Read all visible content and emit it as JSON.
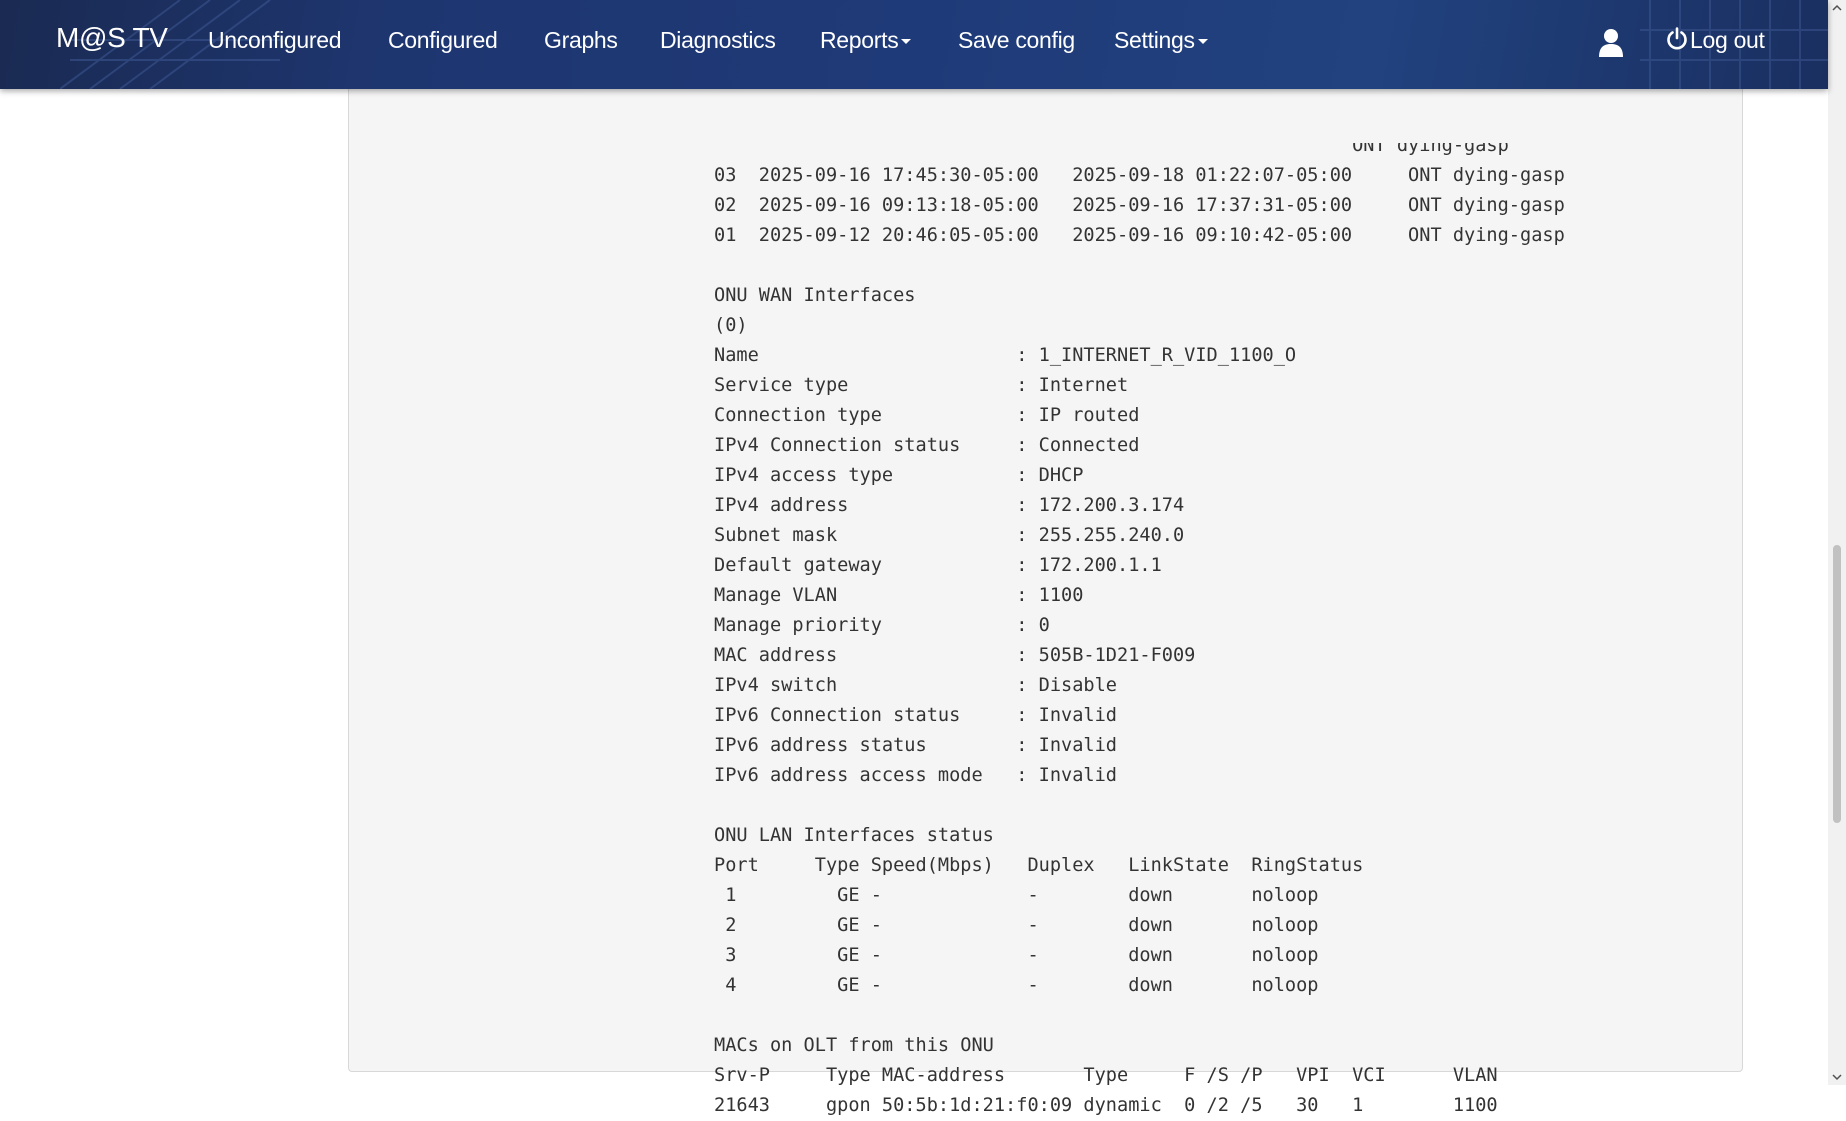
{
  "navbar": {
    "brand": "M@S TV",
    "items": [
      {
        "label": "Unconfigured"
      },
      {
        "label": "Configured"
      },
      {
        "label": "Graphs"
      },
      {
        "label": "Diagnostics"
      },
      {
        "label": "Reports"
      },
      {
        "label": "Save config"
      },
      {
        "label": "Settings"
      }
    ],
    "logout_label": "Log out",
    "user_icon": "user-icon",
    "power_icon": "power-icon",
    "colors": {
      "background": "#1f3a78",
      "text": "#ffffff"
    }
  },
  "content": {
    "lines": [
      "                                                         ONT dying-gasp",
      "03  2025-09-16 17:45:30-05:00   2025-09-18 01:22:07-05:00     ONT dying-gasp",
      "02  2025-09-16 09:13:18-05:00   2025-09-16 17:37:31-05:00     ONT dying-gasp",
      "01  2025-09-12 20:46:05-05:00   2025-09-16 09:10:42-05:00     ONT dying-gasp",
      "",
      "ONU WAN Interfaces",
      "(0)",
      "Name                       : 1_INTERNET_R_VID_1100_O",
      "Service type               : Internet",
      "Connection type            : IP routed",
      "IPv4 Connection status     : Connected",
      "IPv4 access type           : DHCP",
      "IPv4 address               : 172.200.3.174",
      "Subnet mask                : 255.255.240.0",
      "Default gateway            : 172.200.1.1",
      "Manage VLAN                : 1100",
      "Manage priority            : 0",
      "MAC address                : 505B-1D21-F009",
      "IPv4 switch                : Disable",
      "IPv6 Connection status     : Invalid",
      "IPv6 address status        : Invalid",
      "IPv6 address access mode   : Invalid",
      "",
      "ONU LAN Interfaces status",
      "Port     Type Speed(Mbps)   Duplex   LinkState  RingStatus",
      " 1         GE -             -        down       noloop",
      " 2         GE -             -        down       noloop",
      " 3         GE -             -        down       noloop",
      " 4         GE -             -        down       noloop",
      "",
      "MACs on OLT from this ONU",
      "Srv-P     Type MAC-address       Type     F /S /P   VPI  VCI      VLAN",
      "21643     gpon 50:5b:1d:21:f0:09 dynamic  0 /2 /5   30   1        1100"
    ]
  }
}
